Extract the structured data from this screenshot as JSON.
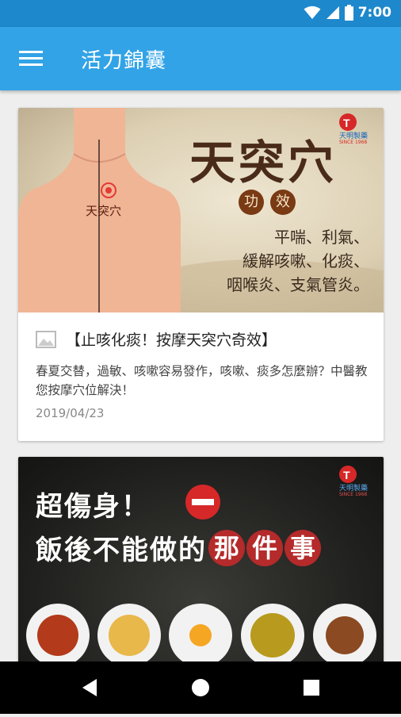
{
  "status_bar": {
    "time": "7:00",
    "icons": [
      "wifi-icon",
      "cell-signal-icon",
      "battery-icon"
    ]
  },
  "app_bar": {
    "title": "活力錦囊",
    "menu_icon": "menu-icon"
  },
  "colors": {
    "status_bar": "#1e88cc",
    "app_bar": "#32a3e6",
    "logo_red": "#d62828"
  },
  "articles": [
    {
      "banner": {
        "headline": "天突穴",
        "badge_chars": [
          "功",
          "效"
        ],
        "effects": [
          "平喘、利氣、",
          "緩解咳嗽、化痰、",
          "咽喉炎、支氣管炎。"
        ],
        "point_label": "天突穴",
        "logo_text": "天明製藥",
        "logo_since": "SINCE 1968"
      },
      "title": "【止咳化痰！按摩天突穴奇效】",
      "description": "春夏交替，過敏、咳嗽容易發作，咳嗽、痰多怎麼辦？中醫教您按摩穴位解決！",
      "date": "2019/04/23"
    },
    {
      "banner": {
        "line1": "超傷身！",
        "line2_prefix": "飯後不能做的",
        "line2_highlight": [
          "那",
          "件",
          "事"
        ],
        "logo_text": "天明製藥",
        "logo_since": "SINCE 1968"
      }
    }
  ],
  "nav_bar": {
    "back": "back-icon",
    "home": "home-icon",
    "recents": "recents-icon"
  }
}
